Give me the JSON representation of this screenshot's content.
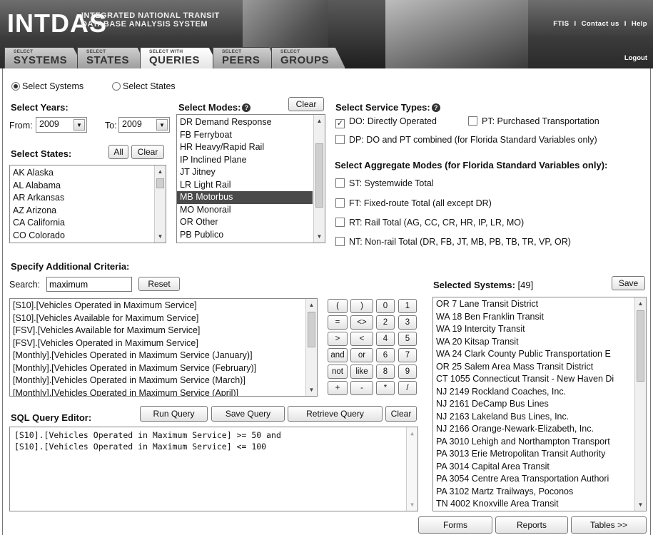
{
  "header": {
    "logo": "INTDAS",
    "subtitle_line1": "INTEGRATED NATIONAL TRANSIT",
    "subtitle_line2": "DATABASE ANALYSIS SYSTEM",
    "links": [
      "FTIS",
      "Contact us",
      "Help"
    ],
    "separator": "I",
    "logout": "Logout",
    "tabs": [
      {
        "small": "SELECT",
        "big": "SYSTEMS"
      },
      {
        "small": "SELECT",
        "big": "STATES"
      },
      {
        "small": "SELECT WITH",
        "big": "QUERIES"
      },
      {
        "small": "SELECT",
        "big": "PEERS"
      },
      {
        "small": "SELECT",
        "big": "GROUPS"
      }
    ]
  },
  "mode": {
    "systems": "Select Systems",
    "states": "Select States"
  },
  "years": {
    "label": "Select Years:",
    "from_label": "From:",
    "from": "2009",
    "to_label": "To:",
    "to": "2009"
  },
  "states": {
    "label": "Select States:",
    "all": "All",
    "clear": "Clear",
    "items": [
      "AK Alaska",
      "AL Alabama",
      "AR Arkansas",
      "AZ Arizona",
      "CA California",
      "CO Colorado"
    ]
  },
  "modes": {
    "label": "Select Modes:",
    "clear": "Clear",
    "items": [
      "DR Demand Response",
      "FB Ferryboat",
      "HR Heavy/Rapid Rail",
      "IP Inclined Plane",
      "JT Jitney",
      "LR Light Rail",
      "MB Motorbus",
      "MO Monorail",
      "OR Other",
      "PB Publico"
    ],
    "selected": "MB Motorbus"
  },
  "service": {
    "label": "Select Service Types:",
    "do": "DO: Directly Operated",
    "pt": "PT: Purchased Transportation",
    "dp": "DP: DO and PT combined (for Florida Standard Variables only)"
  },
  "aggregate": {
    "label": "Select Aggregate Modes (for Florida Standard Variables only):",
    "st": "ST: Systemwide Total",
    "ft": "FT: Fixed-route Total (all except DR)",
    "rt": "RT: Rail Total (AG, CC, CR, HR, IP, LR, MO)",
    "nt": "NT: Non-rail Total (DR, FB, JT, MB, PB, TB, TR, VP, OR)"
  },
  "criteria": {
    "label": "Specify Additional Criteria:",
    "search_label": "Search:",
    "search_value": "maximum",
    "reset": "Reset",
    "items": [
      "[S10].[Vehicles Operated in Maximum Service]",
      "[S10].[Vehicles Available for Maximum Service]",
      "[FSV].[Vehicles Available for Maximum Service]",
      "[FSV].[Vehicles Operated in Maximum Service]",
      "[Monthly].[Vehicles Operated in Maximum Service (January)]",
      "[Monthly].[Vehicles Operated in Maximum Service (February)]",
      "[Monthly].[Vehicles Operated in Maximum Service (March)]",
      "[Monthly].[Vehicles Operated in Maximum Service (April)]"
    ]
  },
  "operators": [
    [
      "(",
      ")",
      "0",
      "1"
    ],
    [
      "=",
      "<>",
      "2",
      "3"
    ],
    [
      ">",
      "<",
      "4",
      "5"
    ],
    [
      "and",
      "or",
      "6",
      "7"
    ],
    [
      "not",
      "like",
      "8",
      "9"
    ],
    [
      "+",
      "-",
      "*",
      "/"
    ]
  ],
  "sql": {
    "label": "SQL Query Editor:",
    "run": "Run Query",
    "save": "Save Query",
    "retrieve": "Retrieve Query",
    "clear": "Clear",
    "line1": "[S10].[Vehicles Operated in Maximum Service] >= 50 and",
    "line2": "[S10].[Vehicles Operated in Maximum Service] <= 100"
  },
  "selected_systems": {
    "label": "Selected Systems:",
    "count": "[49]",
    "save": "Save",
    "items": [
      "OR 7 Lane Transit District",
      "WA 18 Ben Franklin Transit",
      "WA 19 Intercity Transit",
      "WA 20 Kitsap Transit",
      "WA 24 Clark County Public Transportation E",
      "OR 25 Salem Area Mass Transit District",
      "CT 1055 Connecticut Transit - New Haven Di",
      "NJ 2149 Rockland Coaches, Inc.",
      "NJ 2161 DeCamp Bus Lines",
      "NJ 2163 Lakeland Bus Lines, Inc.",
      "NJ 2166 Orange-Newark-Elizabeth, Inc.",
      "PA 3010 Lehigh and Northampton Transport",
      "PA 3013 Erie Metropolitan Transit Authority",
      "PA 3014 Capital Area Transit",
      "PA 3054 Centre Area Transportation Authori",
      "PA 3102 Martz Trailways, Poconos",
      "TN 4002 Knoxville Area Transit"
    ]
  },
  "footer": {
    "forms": "Forms",
    "reports": "Reports",
    "tables": "Tables >>"
  }
}
